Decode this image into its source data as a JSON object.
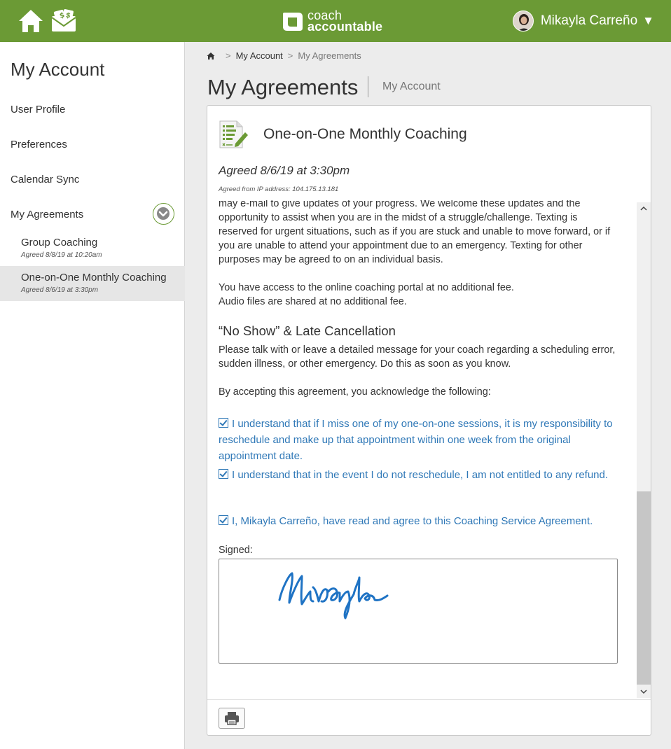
{
  "header": {
    "logo_line1": "coach",
    "logo_line2": "accountable",
    "user_name": "Mikayla Carreño",
    "user_caret": "▼",
    "brand_color": "#6b9a35",
    "icons": [
      "home-icon",
      "money-icon",
      "chevron-down-icon"
    ]
  },
  "sidebar": {
    "title": "My Account",
    "items": [
      {
        "label": "User Profile"
      },
      {
        "label": "Preferences"
      },
      {
        "label": "Calendar Sync"
      },
      {
        "label": "My Agreements"
      }
    ],
    "agreements": [
      {
        "title": "Group Coaching",
        "date": "Agreed 8/8/19 at 10:20am"
      },
      {
        "title": "One-on-One Monthly Coaching",
        "date": "Agreed 8/6/19 at 3:30pm"
      }
    ]
  },
  "breadcrumb": {
    "sep1": ">",
    "link": "My Account",
    "sep2": ">",
    "current": "My Agreements"
  },
  "page": {
    "title": "My Agreements",
    "subtitle": "My Account"
  },
  "agreement": {
    "title": "One-on-One Monthly Coaching",
    "agreed": "Agreed 8/6/19 at 3:30pm",
    "ip": "Agreed from IP address: 104.175.13.181",
    "para1": "may e-mail to give updates of your progress. We welcome these updates and the opportunity to assist when you are in the midst of a struggle/challenge. Texting is reserved for urgent situations, such as if you are stuck and unable to move forward, or if you are unable to attend your appointment due to an emergency. Texting for other purposes may be agreed to on an individual basis.",
    "para2a": "You have access to the online coaching portal at no additional fee.",
    "para2b": "Audio files are shared at no additional fee.",
    "section_heading": "“No Show” & Late Cancellation",
    "para3": "Please talk with or leave a detailed message for your coach regarding a scheduling error, sudden illness, or other emergency.  Do this as soon as you know.",
    "para4": "By accepting this agreement, you acknowledge the following:",
    "check1": "I understand that if I miss one of my one-on-one sessions, it is my responsibility to reschedule and make up that appointment within one week from the original appointment date.",
    "check2": "I understand that in the event I do not reschedule, I am not entitled to any refund.",
    "check3": "I, Mikayla Carreño, have read and agree to this Coaching Service Agreement.",
    "signed_label": "Signed:",
    "signature_color": "#1f73c4"
  }
}
